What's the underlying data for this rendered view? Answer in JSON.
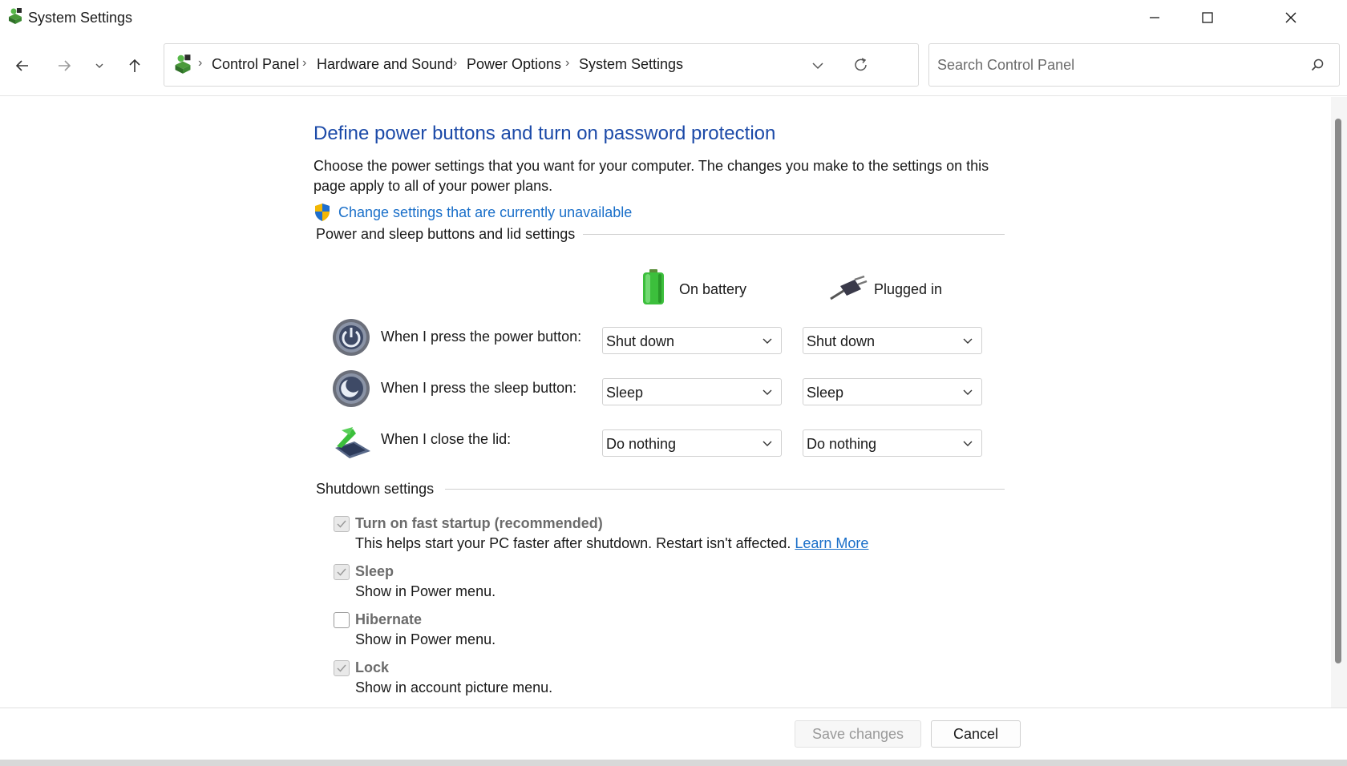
{
  "window": {
    "title": "System Settings",
    "controls": {
      "minimize": "minimize",
      "maximize": "maximize",
      "close": "close"
    }
  },
  "nav": {
    "breadcrumbs": [
      "Control Panel",
      "Hardware and Sound",
      "Power Options",
      "System Settings"
    ],
    "search_placeholder": "Search Control Panel"
  },
  "main": {
    "title": "Define power buttons and turn on password protection",
    "description": "Choose the power settings that you want for your computer. The changes you make to the settings on this page apply to all of your power plans.",
    "change_link": "Change settings that are currently unavailable",
    "power_section": {
      "heading": "Power and sleep buttons and lid settings",
      "columns": {
        "battery": "On battery",
        "plugged": "Plugged in"
      },
      "rows": [
        {
          "label": "When I press the power button:",
          "battery": "Shut down",
          "plugged": "Shut down",
          "icon": "power-button-icon"
        },
        {
          "label": "When I press the sleep button:",
          "battery": "Sleep",
          "plugged": "Sleep",
          "icon": "sleep-button-icon"
        },
        {
          "label": "When I close the lid:",
          "battery": "Do nothing",
          "plugged": "Do nothing",
          "icon": "laptop-lid-icon"
        }
      ]
    },
    "shutdown_section": {
      "heading": "Shutdown settings",
      "options": [
        {
          "title": "Turn on fast startup (recommended)",
          "desc": "This helps start your PC faster after shutdown. Restart isn't affected.",
          "link": "Learn More",
          "checked": true
        },
        {
          "title": "Sleep",
          "desc": "Show in Power menu.",
          "checked": true
        },
        {
          "title": "Hibernate",
          "desc": "Show in Power menu.",
          "checked": false
        },
        {
          "title": "Lock",
          "desc": "Show in account picture menu.",
          "checked": true
        }
      ]
    }
  },
  "footer": {
    "save": "Save changes",
    "cancel": "Cancel"
  },
  "colors": {
    "title_blue": "#1c4aa8",
    "link_blue": "#1a6fc9",
    "battery_green": "#3cbf3c"
  }
}
